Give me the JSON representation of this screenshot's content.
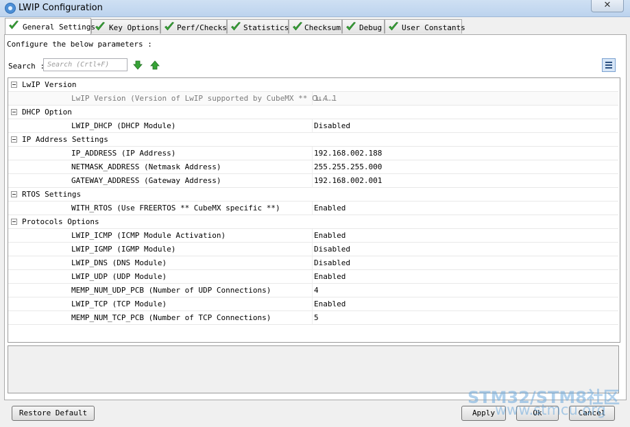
{
  "window": {
    "title": "LWIP Configuration",
    "close_glyph": "✕"
  },
  "tabs": [
    {
      "label": "General Settings",
      "active": true
    },
    {
      "label": "Key Options"
    },
    {
      "label": "Perf/Checks"
    },
    {
      "label": "Statistics"
    },
    {
      "label": "Checksum"
    },
    {
      "label": "Debug"
    },
    {
      "label": "User Constants"
    }
  ],
  "intro": "Configure the below parameters :",
  "search": {
    "label": "Search :",
    "placeholder": "Search (Crtl+F)"
  },
  "groups": [
    {
      "name": "LwIP Version",
      "params": [
        {
          "name": "LwIP Version (Version of LwIP supported by CubeMX ** Cu...",
          "value": "1.4.1",
          "readonly": true
        }
      ]
    },
    {
      "name": "DHCP Option",
      "params": [
        {
          "name": "LWIP_DHCP (DHCP Module)",
          "value": "Disabled"
        }
      ]
    },
    {
      "name": "IP Address Settings",
      "params": [
        {
          "name": "IP_ADDRESS (IP Address)",
          "value": "192.168.002.188"
        },
        {
          "name": "NETMASK_ADDRESS (Netmask Address)",
          "value": "255.255.255.000"
        },
        {
          "name": "GATEWAY_ADDRESS (Gateway Address)",
          "value": "192.168.002.001"
        }
      ]
    },
    {
      "name": "RTOS Settings",
      "params": [
        {
          "name": "WITH_RTOS (Use FREERTOS ** CubeMX specific **)",
          "value": "Enabled"
        }
      ]
    },
    {
      "name": "Protocols Options",
      "params": [
        {
          "name": "LWIP_ICMP (ICMP Module Activation)",
          "value": "Enabled"
        },
        {
          "name": "LWIP_IGMP (IGMP Module)",
          "value": "Disabled"
        },
        {
          "name": "LWIP_DNS (DNS Module)",
          "value": "Disabled"
        },
        {
          "name": "LWIP_UDP (UDP Module)",
          "value": "Enabled"
        },
        {
          "name": "MEMP_NUM_UDP_PCB (Number of UDP Connections)",
          "value": "4"
        },
        {
          "name": "LWIP_TCP (TCP Module)",
          "value": "Enabled"
        },
        {
          "name": "MEMP_NUM_TCP_PCB (Number of TCP Connections)",
          "value": "5"
        }
      ]
    }
  ],
  "buttons": {
    "restore": "Restore Default",
    "apply": "Apply",
    "ok": "Ok",
    "cancel": "Cancel"
  },
  "watermark": {
    "line1": "STM32/STM8社区",
    "line2": "www.stmcu.org"
  },
  "colors": {
    "check_green": "#3aa63a",
    "arrow_green": "#37a337",
    "view_button": "#d7e6f7"
  },
  "icons": {
    "tab_check": "check-icon",
    "search_next": "arrow-down-icon",
    "search_prev": "arrow-up-icon",
    "view_toggle": "list-view-icon"
  }
}
